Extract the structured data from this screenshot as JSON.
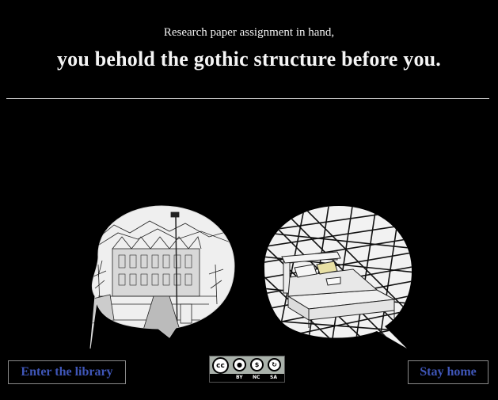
{
  "intro": "Research paper assignment in hand,",
  "headline": "you behold the gothic structure before you.",
  "choices": {
    "left_label": "Enter the library",
    "right_label": "Stay home"
  },
  "license": {
    "main_glyph": "cc",
    "labels": [
      "BY",
      "NC",
      "SA"
    ]
  },
  "colors": {
    "background": "#000000",
    "link": "#3f56b8",
    "text": "#f5f5f5"
  },
  "icons": [
    "library-sketch",
    "bed-sketch",
    "creative-commons-badge"
  ]
}
